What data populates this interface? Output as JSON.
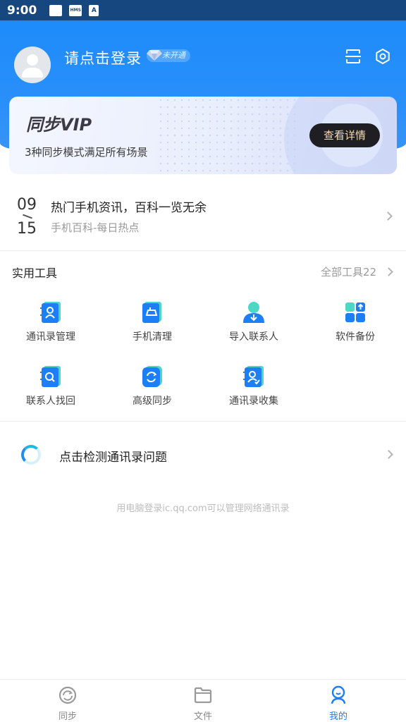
{
  "status_bar": {
    "time": "9:00",
    "icons": [
      "notification-icon",
      "hms-icon",
      "font-icon"
    ],
    "icon_texts": [
      "",
      "HMS",
      "A"
    ]
  },
  "header": {
    "login_text": "请点击登录",
    "vip_badge": "未开通",
    "icons": [
      "scan-icon",
      "settings-icon"
    ]
  },
  "vip_card": {
    "title": "同步VIP",
    "subtitle": "3种同步模式满足所有场景",
    "button": "查看详情"
  },
  "news": {
    "month": "09",
    "day": "15",
    "title": "热门手机资讯，百科一览无余",
    "subtitle": "手机百科-每日热点"
  },
  "tools": {
    "title": "实用工具",
    "all_label": "全部工具22",
    "items": [
      {
        "label": "通讯录管理",
        "icon": "contacts-manage-icon"
      },
      {
        "label": "手机清理",
        "icon": "phone-clean-icon"
      },
      {
        "label": "导入联系人",
        "icon": "import-contact-icon"
      },
      {
        "label": "软件备份",
        "icon": "app-backup-icon"
      },
      {
        "label": "联系人找回",
        "icon": "contact-recover-icon"
      },
      {
        "label": "高级同步",
        "icon": "advanced-sync-icon"
      },
      {
        "label": "通讯录收集",
        "icon": "contact-collect-icon"
      }
    ]
  },
  "detect": {
    "text": "点击检测通讯录问题"
  },
  "footnote": "用电脑登录ic.qq.com可以管理网络通讯录",
  "bottom_nav": {
    "items": [
      {
        "label": "同步",
        "icon": "sync-icon",
        "active": false
      },
      {
        "label": "文件",
        "icon": "folder-icon",
        "active": false
      },
      {
        "label": "我的",
        "icon": "profile-icon",
        "active": true
      }
    ]
  },
  "colors": {
    "primary": "#1c7ff5",
    "header_top": "#1d8cfb",
    "status_bar": "#16477f",
    "vip_button": "#1f1f23",
    "vip_button_text": "#f4dcb1"
  }
}
